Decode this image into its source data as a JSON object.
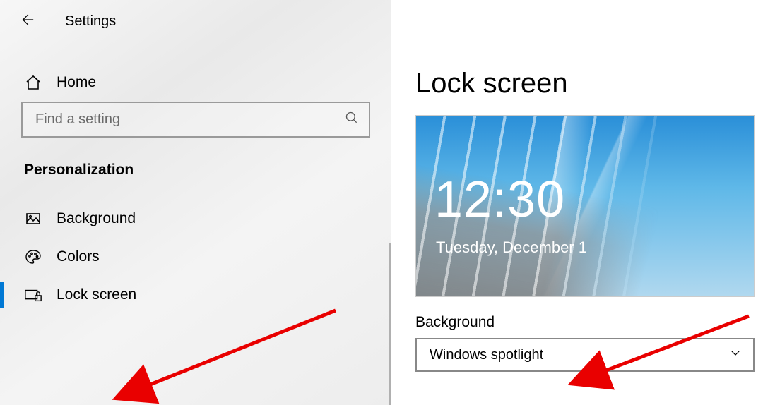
{
  "header": {
    "app_title": "Settings"
  },
  "search": {
    "placeholder": "Find a setting"
  },
  "home": {
    "label": "Home"
  },
  "section": {
    "title": "Personalization"
  },
  "nav": {
    "background": {
      "label": "Background"
    },
    "colors": {
      "label": "Colors"
    },
    "lockscreen": {
      "label": "Lock screen"
    }
  },
  "main": {
    "title": "Lock screen",
    "preview_time": "12:30",
    "preview_date": "Tuesday, December 1",
    "bg_label": "Background",
    "bg_value": "Windows spotlight"
  }
}
